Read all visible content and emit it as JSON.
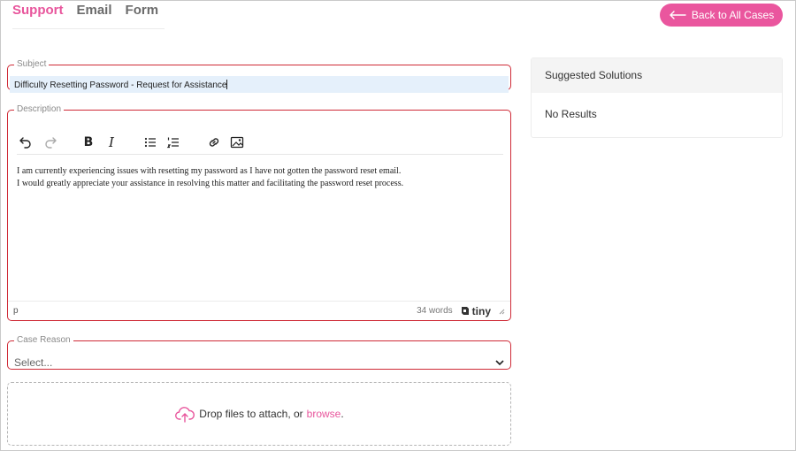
{
  "tabs": [
    {
      "label": "Support",
      "active": true
    },
    {
      "label": "Email",
      "active": false
    },
    {
      "label": "Form",
      "active": false
    }
  ],
  "back_button": {
    "label": "Back to All Cases",
    "icon": "arrow-left-icon"
  },
  "subject": {
    "legend": "Subject",
    "value": "Difficulty Resetting Password - Request for Assistance"
  },
  "description": {
    "legend": "Description",
    "toolbar": [
      "undo-icon",
      "redo-icon",
      "bold-icon",
      "italic-icon",
      "bullet-list-icon",
      "numbered-list-icon",
      "link-icon",
      "image-icon"
    ],
    "bold_glyph": "B",
    "italic_glyph": "I",
    "lines": [
      "I am currently experiencing issues with resetting my password as I have not gotten the password reset email.",
      "I would greatly appreciate your assistance in resolving this matter and facilitating the password reset process."
    ],
    "element_path": "p",
    "word_count": "34 words",
    "brand": "tiny"
  },
  "case_reason": {
    "legend": "Case Reason",
    "selected": "Select..."
  },
  "dropzone": {
    "text": "Drop files to attach, or",
    "link": "browse",
    "suffix": "."
  },
  "suggested": {
    "title": "Suggested Solutions",
    "empty": "No Results"
  },
  "colors": {
    "accent": "#ea569e",
    "error_border": "#cf2a36",
    "subject_fill": "#e5f0fb"
  }
}
